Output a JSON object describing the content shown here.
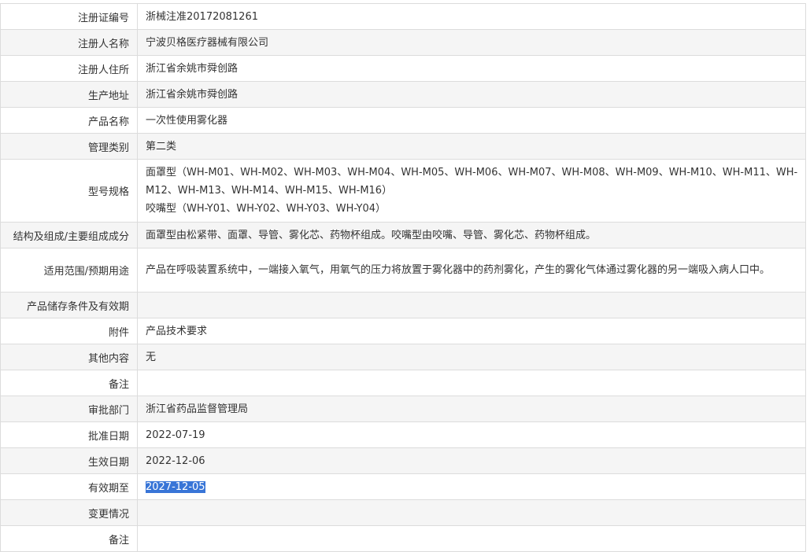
{
  "rows": [
    {
      "label": "注册证编号",
      "value": "浙械注准20172081261"
    },
    {
      "label": "注册人名称",
      "value": "宁波贝格医疗器械有限公司"
    },
    {
      "label": "注册人住所",
      "value": "浙江省余姚市舜创路"
    },
    {
      "label": "生产地址",
      "value": "浙江省余姚市舜创路"
    },
    {
      "label": "产品名称",
      "value": "一次性使用雾化器"
    },
    {
      "label": "管理类别",
      "value": "第二类"
    },
    {
      "label": "型号规格",
      "value_lines": [
        "面罩型（WH-M01、WH-M02、WH-M03、WH-M04、WH-M05、WH-M06、WH-M07、WH-M08、WH-M09、WH-M10、WH-M11、WH-M12、WH-M13、WH-M14、WH-M15、WH-M16）",
        "咬嘴型（WH-Y01、WH-Y02、WH-Y03、WH-Y04）"
      ]
    },
    {
      "label": "结构及组成/主要组成成分",
      "value": "面罩型由松紧带、面罩、导管、雾化芯、药物杯组成。咬嘴型由咬嘴、导管、雾化芯、药物杯组成。"
    },
    {
      "label": "适用范围/预期用途",
      "value": "产品在呼吸装置系统中，一端接入氧气，用氧气的压力将放置于雾化器中的药剂雾化，产生的雾化气体通过雾化器的另一端吸入病人口中。"
    },
    {
      "label": "产品储存条件及有效期",
      "value": ""
    },
    {
      "label": "附件",
      "value": "产品技术要求"
    },
    {
      "label": "其他内容",
      "value": "无"
    },
    {
      "label": "备注",
      "value": ""
    },
    {
      "label": "审批部门",
      "value": "浙江省药品监督管理局"
    },
    {
      "label": "批准日期",
      "value": "2022-07-19"
    },
    {
      "label": "生效日期",
      "value": "2022-12-06"
    },
    {
      "label": "有效期至",
      "value": "2027-12-05"
    },
    {
      "label": "变更情况",
      "value": ""
    },
    {
      "label": "备注",
      "value": ""
    }
  ]
}
